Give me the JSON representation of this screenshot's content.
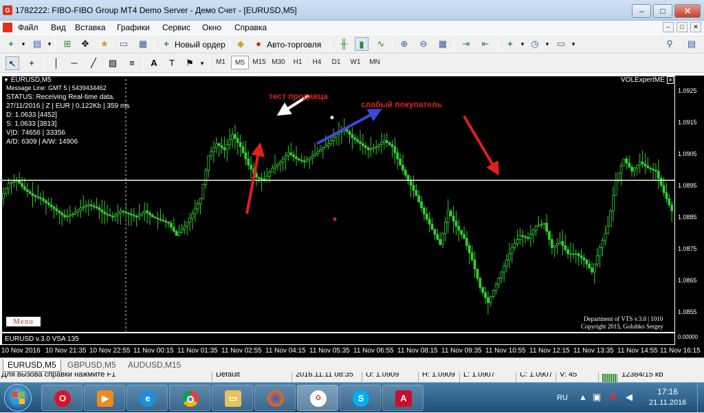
{
  "window": {
    "title": "1782222: FIBO-FIBO Group MT4 Demo Server - Демо Счет - [EURUSD,M5]",
    "min": "–",
    "max": "□",
    "close": "✕"
  },
  "menu": {
    "items": [
      "Файл",
      "Вид",
      "Вставка",
      "Графики",
      "Сервис",
      "Окно",
      "Справка"
    ],
    "mdi": [
      "–",
      "□",
      "✕"
    ]
  },
  "toolbar": {
    "new_order": "Новый ордер",
    "autotrade": "Авто-торговля"
  },
  "timeframes": [
    "M1",
    "M5",
    "M15",
    "M30",
    "H1",
    "H4",
    "D1",
    "W1",
    "MN"
  ],
  "active_timeframe": "M5",
  "chart": {
    "symbol": "EURUSD,M5",
    "indicator_name": "VOLExpertME",
    "info_lines": [
      "Message Line: GMT 5 | 5439434462",
      "STATUS:  Receiving Real-time data.",
      "27/11/2016 | Z | EUR | 0.122Kb | 359 ms",
      "D: 1.0633  [4452]",
      "S: 1.0633  [3813]",
      "V|D: 74656 | 33356",
      "A/D: 6309 | A/W: 14906"
    ],
    "menu_label": "Menu",
    "annotations": {
      "seller_test": "тест продавца",
      "weak_buyer": "слабый покупатель"
    },
    "credits": [
      "Department of VTS  v.3.0 | 1010",
      "Copyright 2015, Golubko Sergey"
    ],
    "subwindow": "EURUSD v.3.0 VSA 135",
    "subwindow_value": "0.00000",
    "colors": {
      "candles": "#32cd32",
      "level": "#fffde0",
      "seller_arrow": "#e02020",
      "buyer_arrow": "#3a4ad8",
      "white_arrow": "#ffffff"
    }
  },
  "chart_data": {
    "type": "line",
    "title": "EURUSD,M5",
    "ylim": [
      1.0848,
      1.0932
    ],
    "yticks": [
      "1.0925",
      "1.0915",
      "1.0905",
      "1.0895",
      "1.0885",
      "1.0875",
      "1.0865",
      "1.0855"
    ],
    "xticks": [
      "10 Nov 2016",
      "10 Nov 21:35",
      "10 Nov 22:55",
      "11 Nov 00:15",
      "11 Nov 01:35",
      "11 Nov 02:55",
      "11 Nov 04:15",
      "11 Nov 05:35",
      "11 Nov 06:55",
      "11 Nov 08:15",
      "11 Nov 09:35",
      "11 Nov 10:55",
      "11 Nov 12:15",
      "11 Nov 13:35",
      "11 Nov 14:55",
      "11 Nov 16:15"
    ],
    "level": 1.0898,
    "series": [
      {
        "values": [
          1.0892,
          1.0897,
          1.0898,
          1.0895,
          1.0893,
          1.0892,
          1.089,
          1.0888,
          1.0886,
          1.0887,
          1.0889,
          1.089,
          1.0889,
          1.0887,
          1.0886,
          1.0888,
          1.0887,
          1.0886,
          1.0888,
          1.0886,
          1.0885,
          1.0884,
          1.088,
          1.0883,
          1.0887,
          1.0892,
          1.0906,
          1.091,
          1.0908,
          1.0913,
          1.0909,
          1.0903,
          1.0899,
          1.0898,
          1.0902,
          1.0904,
          1.0907,
          1.0905,
          1.0904,
          1.0906,
          1.0908,
          1.091,
          1.0913,
          1.0915,
          1.0912,
          1.091,
          1.0908,
          1.0909,
          1.0911,
          1.0909,
          1.0903,
          1.0898,
          1.0893,
          1.0887,
          1.0882,
          1.0877,
          1.0888,
          1.0883,
          1.0879,
          1.0872,
          1.0863,
          1.0858,
          1.0864,
          1.087,
          1.0876,
          1.088,
          1.0879,
          1.0883,
          1.0884,
          1.0876,
          1.0878,
          1.0874,
          1.0874,
          1.0872,
          1.0868,
          1.0876,
          1.0883,
          1.0898,
          1.0905,
          1.0901,
          1.0904,
          1.0902,
          1.0901,
          1.0894,
          1.0888
        ]
      }
    ]
  },
  "tabs": [
    "EURUSD,M5",
    "GBPUSD,M5",
    "AUDUSD,M15"
  ],
  "status": {
    "help": "Для вызова справки нажмите F1",
    "profile": "Default",
    "time": "2016.11.11 08:35",
    "open": "O: 1.0909",
    "high": "H: 1.0909",
    "low": "L: 1.0907",
    "close": "C: 1.0907",
    "volume": "V: 45",
    "traffic": "12384/15 kb"
  },
  "taskbar": {
    "apps": [
      "opera-icon",
      "media-player-icon",
      "ie-icon",
      "chrome-icon",
      "explorer-icon",
      "firefox-icon",
      "fibo-icon",
      "skype-icon",
      "pdf-icon"
    ],
    "lang": "RU",
    "clock_time": "17:16",
    "clock_date": "21.11.2016"
  }
}
